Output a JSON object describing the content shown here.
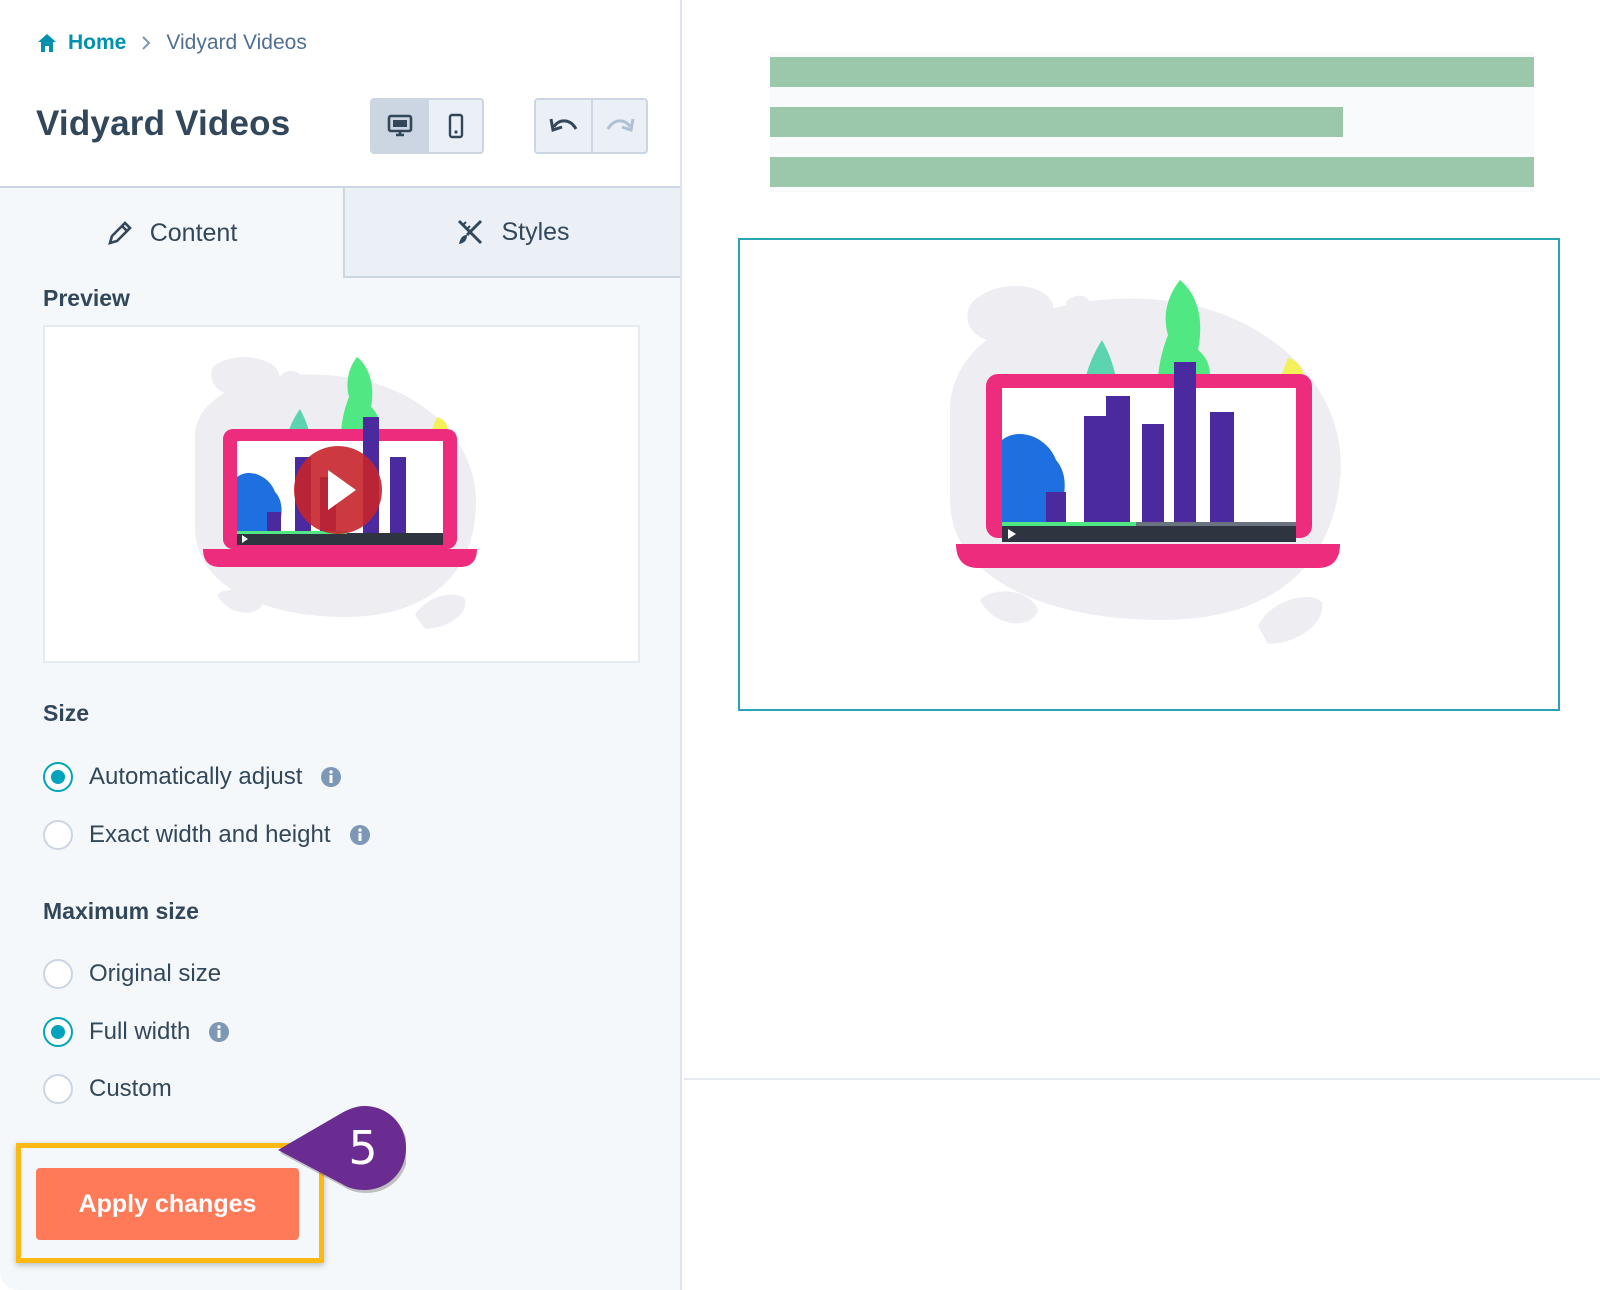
{
  "breadcrumb": {
    "home": "Home",
    "current": "Vidyard Videos"
  },
  "header": {
    "title": "Vidyard Videos"
  },
  "toolbar": {
    "device_buttons": [
      {
        "icon": "desktop-icon",
        "active": true
      },
      {
        "icon": "mobile-icon",
        "active": false
      }
    ],
    "history_buttons": [
      {
        "icon": "undo-icon"
      },
      {
        "icon": "redo-icon"
      }
    ]
  },
  "tabs": [
    {
      "label": "Content",
      "icon": "pencil-icon",
      "active": true
    },
    {
      "label": "Styles",
      "icon": "brush-ruler-icon",
      "active": false
    }
  ],
  "preview": {
    "label": "Preview"
  },
  "size": {
    "label": "Size",
    "options": [
      {
        "label": "Automatically adjust",
        "checked": true,
        "info": true
      },
      {
        "label": "Exact width and height",
        "checked": false,
        "info": true
      }
    ]
  },
  "max_size": {
    "label": "Maximum size",
    "options": [
      {
        "label": "Original size",
        "checked": false,
        "info": false
      },
      {
        "label": "Full width",
        "checked": true,
        "info": true
      },
      {
        "label": "Custom",
        "checked": false,
        "info": false
      }
    ]
  },
  "apply": {
    "label": "Apply changes"
  },
  "step": {
    "number": "5"
  },
  "colors": {
    "accent": "#00a4bd",
    "button": "#ff7a59",
    "highlight": "#fdb913",
    "badge": "#6a2c91",
    "text_placeholder": "#9bc8ab",
    "frame": "#2aa3b5"
  }
}
